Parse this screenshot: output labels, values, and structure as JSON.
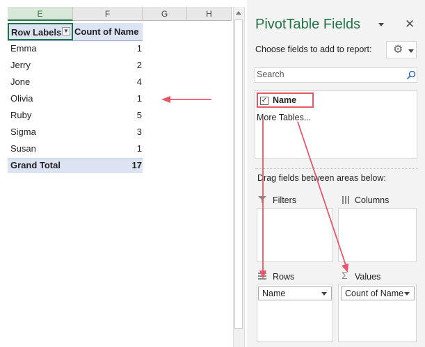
{
  "sheet": {
    "columns": [
      "E",
      "F",
      "G",
      "H"
    ],
    "header": {
      "row_labels": "Row Labels",
      "count": "Count of Name"
    },
    "rows": [
      {
        "label": "Emma",
        "value": "1"
      },
      {
        "label": "Jerry",
        "value": "2"
      },
      {
        "label": "Jone",
        "value": "4"
      },
      {
        "label": "Olivia",
        "value": "1"
      },
      {
        "label": "Ruby",
        "value": "5"
      },
      {
        "label": "Sigma",
        "value": "3"
      },
      {
        "label": "Susan",
        "value": "1"
      }
    ],
    "grand_total": {
      "label": "Grand Total",
      "value": "17"
    }
  },
  "pane": {
    "title": "PivotTable Fields",
    "choose_label": "Choose fields to add to report:",
    "search_placeholder": "Search",
    "field_name": "Name",
    "field_checked": true,
    "more_tables": "More Tables...",
    "drag_label": "Drag fields between areas below:",
    "areas": {
      "filters": "Filters",
      "columns": "Columns",
      "rows": "Rows",
      "values": "Values"
    },
    "rows_field": "Name",
    "values_field": "Count of Name"
  },
  "colors": {
    "accent_green": "#217346",
    "pivot_header": "#dce3f3",
    "annotation_red": "#e8566c",
    "pane_title": "#217346"
  },
  "icons": [
    "dropdown-icon",
    "close-icon",
    "gear-icon",
    "search-icon",
    "checkbox-icon",
    "filter-icon",
    "columns-icon",
    "rows-icon",
    "sigma-icon",
    "chevron-down-icon"
  ]
}
